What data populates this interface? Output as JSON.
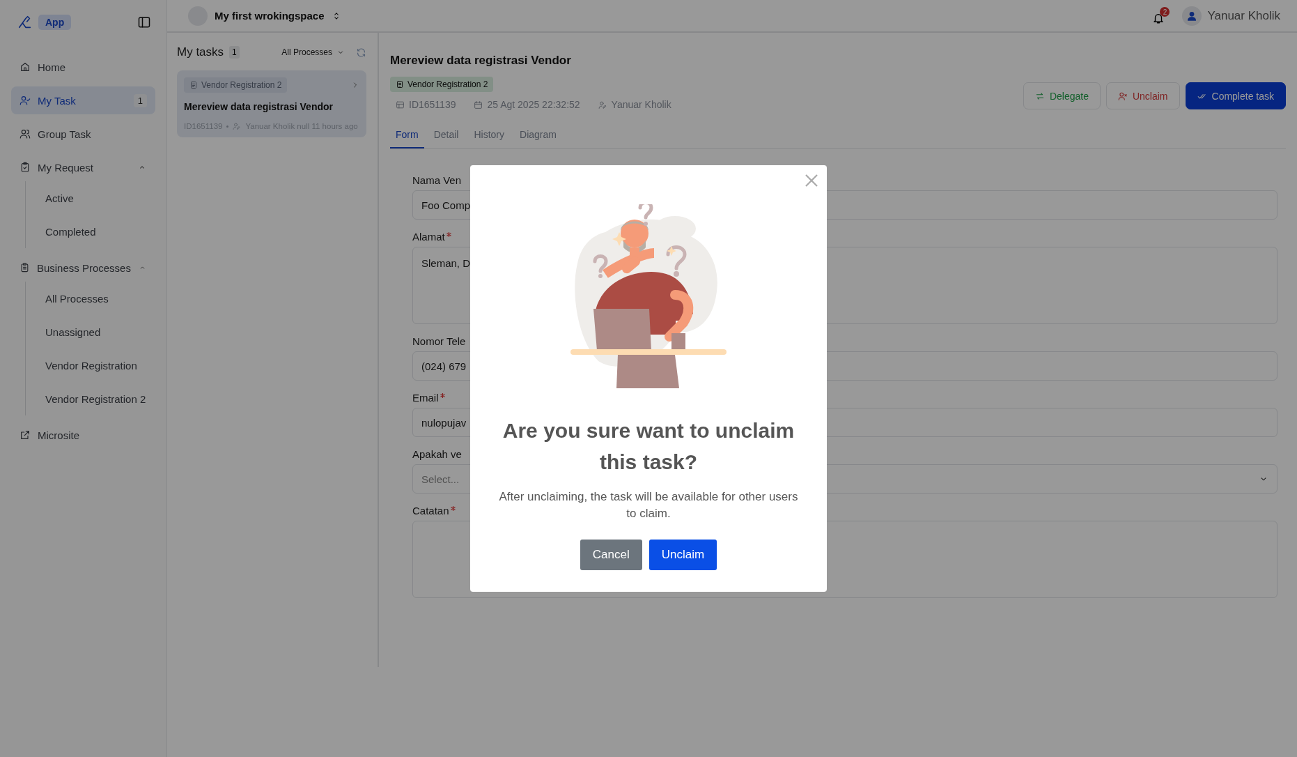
{
  "sidebar": {
    "logo_badge": "App",
    "items": [
      {
        "label": "Home",
        "selected": false
      },
      {
        "label": "My Task",
        "selected": true,
        "badge": "1"
      },
      {
        "label": "Group Task",
        "selected": false
      },
      {
        "label": "My Request",
        "selected": false,
        "expanded": true,
        "children": [
          {
            "label": "Active",
            "selected": false
          },
          {
            "label": "Completed",
            "selected": false
          }
        ]
      },
      {
        "label": "Business Processes",
        "selected": false,
        "expanded": true,
        "children": [
          {
            "label": "All Processes",
            "selected": false
          },
          {
            "label": "Unassigned",
            "selected": false
          },
          {
            "label": "Vendor Registration",
            "selected": false
          },
          {
            "label": "Vendor Registration 2",
            "selected": false
          }
        ]
      },
      {
        "label": "Microsite",
        "selected": false
      }
    ]
  },
  "top_bar": {
    "workspace": "My first wrokingspace",
    "notifications": "2",
    "user": "Yanuar Kholik"
  },
  "task_list": {
    "title": "My tasks",
    "count": "1",
    "filter": "All Processes",
    "tasks": [
      {
        "process": "Vendor Registration 2",
        "title": "Mereview data registrasi Vendor",
        "id": "ID1651139",
        "meta": "Yanuar Kholik null 11 hours ago",
        "selected": true
      }
    ]
  },
  "task_detail": {
    "title": "Mereview data registrasi Vendor",
    "process": "Vendor Registration 2",
    "id": "ID1651139",
    "date": "25 Agt 2025 22:32:52",
    "assignee": "Yanuar Kholik",
    "actions": [
      {
        "label": "Delegate",
        "kind": "delegate"
      },
      {
        "label": "Unclaim",
        "kind": "unclaim"
      },
      {
        "label": "Complete task",
        "kind": "complete"
      }
    ],
    "tabs": [
      {
        "label": "Form",
        "selected": true
      },
      {
        "label": "Detail",
        "selected": false
      },
      {
        "label": "History",
        "selected": false
      },
      {
        "label": "Diagram",
        "selected": false
      }
    ],
    "fields": [
      {
        "label": "Nama Ven",
        "kind": "input",
        "required": false,
        "value": "Foo Comp"
      },
      {
        "label": "Alamat",
        "kind": "textarea",
        "required": true,
        "value": "Sleman, D"
      },
      {
        "label": "Nomor Tele",
        "kind": "input",
        "required": false,
        "value": "(024) 679"
      },
      {
        "label": "Email",
        "kind": "input",
        "required": true,
        "value": "nulopujav"
      },
      {
        "label": "Apakah ve",
        "kind": "select",
        "required": false,
        "placeholder": "Select..."
      },
      {
        "label": "Catatan",
        "kind": "textarea",
        "required": true
      }
    ]
  },
  "dialog": {
    "title": "Are you sure want to unclaim this task?",
    "message": "After unclaiming, the task will be available for other users to claim.",
    "buttons": [
      {
        "label": "Cancel",
        "kind": "secondary"
      },
      {
        "label": "Unclaim",
        "kind": "primary"
      }
    ]
  }
}
